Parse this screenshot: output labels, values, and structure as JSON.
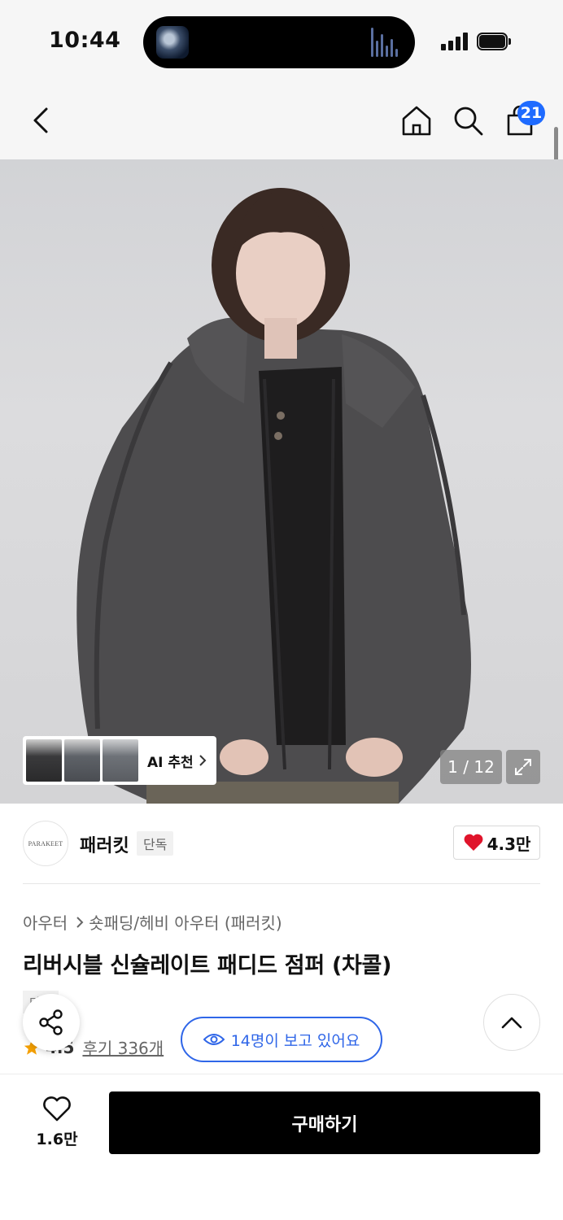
{
  "status_bar": {
    "time": "10:44"
  },
  "nav": {
    "back_icon": "chevron-left-icon",
    "home_icon": "home-icon",
    "search_icon": "search-icon",
    "cart_icon": "shopping-bag-icon",
    "cart_badge": "21",
    "badge_color": "#1f6bff"
  },
  "gallery": {
    "ai_recommend_label": "AI 추천",
    "page_counter": "1 / 12",
    "expand_icon": "expand-icon"
  },
  "brand": {
    "logo_text": "PARAKEET",
    "name": "패러킷",
    "tag": "단독",
    "like_count": "4.3만",
    "like_color": "#e0142b"
  },
  "product": {
    "breadcrumb": [
      "아우터",
      "숏패딩/헤비 아우터 (패러킷)"
    ],
    "title": "리버시블 신슐레이트 패디드 점퍼 (차콜)",
    "exclusive_tag": "단독",
    "rating": "4.5",
    "review_text": "후기 336개",
    "star_color": "#f5a000"
  },
  "floating": {
    "viewers_text": "14명이 보고 있어요",
    "accent_color": "#2f66e8"
  },
  "bottom_bar": {
    "wishlist_count": "1.6만",
    "buy_label": "구매하기"
  }
}
